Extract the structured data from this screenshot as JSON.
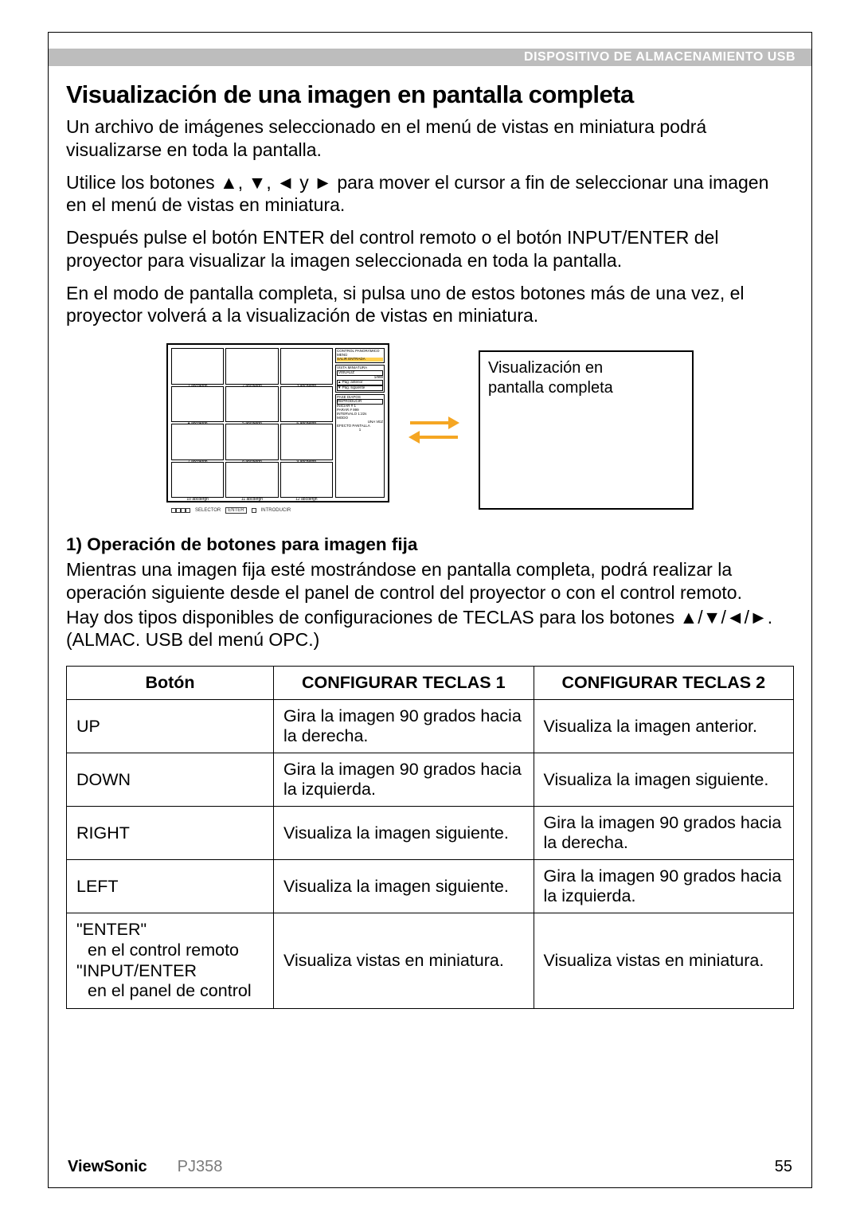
{
  "header": {
    "section": "DISPOSITIVO DE ALMACENAMIENTO USB"
  },
  "title": "Visualización de una imagen en pantalla completa",
  "paragraphs": {
    "p1": "Un archivo de imágenes seleccionado en el menú de vistas en miniatura podrá visualizarse en toda la pantalla.",
    "p2": "Utilice los botones ▲, ▼, ◄ y ► para mover el cursor a fin de seleccionar una imagen en el menú de vistas en miniatura.",
    "p3": "Después pulse el botón ENTER del control remoto o el botón INPUT/ENTER del proyector para visualizar la imagen seleccionada en toda la pantalla.",
    "p4": "En el modo de pantalla completa, si pulsa uno de estos botones más de una vez, el proyector volverá a la visualización de vistas en miniatura."
  },
  "diagram": {
    "thumbnails": {
      "cells": [
        "1 abcdefgh",
        "2 abcdefgh",
        "3 abcdefgh",
        "4 abcdefgh",
        "5 abcdefgh",
        "6 abcdefgh",
        "7 abcdefgh",
        "8 abcdefgh",
        "9 abcdefgh",
        "10 abcdefgh",
        "11 abcdefgh",
        "12 abcdefgh"
      ],
      "side_panel": {
        "control": "CONTROL PANORÁMICO",
        "menu": "MENÚ",
        "salir": "SALIR   ENTRADA",
        "vista_title": "VISTA MINIATURA",
        "visualiz": "VISUALIZ",
        "count": "1/999",
        "prev": "▲ Pág.  anterior",
        "next": "▼ Pág.  siguiente",
        "pase_title": "PASE DIAPOS",
        "reproducir": "REPRODUCIR",
        "iniciar": "INICIAR   #   1",
        "parar": "PARAR    #  999",
        "intervalo": "INTERVALO  1:22s",
        "modo": "MODO",
        "una_vez": "UNA VEZ",
        "efecto": "EFECTO PANTALLA",
        "efecto_val": "1"
      },
      "footer": {
        "selector": "SELECTOR",
        "enter": "ENTER",
        "introducir": "INTRODUCIR"
      }
    },
    "fullscreen_label_line1": "Visualización en",
    "fullscreen_label_line2": "pantalla completa"
  },
  "subheading": "1) Operación de botones para imagen fija",
  "sub_paras": {
    "sp1": "Mientras una imagen fija esté mostrándose en pantalla completa, podrá realizar la operación siguiente desde el panel de control del proyector o con el control remoto.",
    "sp2": "Hay dos tipos disponibles de configuraciones de TECLAS para los botones ▲/▼/◄/►. (ALMAC. USB del menú OPC.)"
  },
  "table": {
    "headers": {
      "h1": "Botón",
      "h2": "CONFIGURAR TECLAS 1",
      "h3": "CONFIGURAR TECLAS 2"
    },
    "rows": [
      {
        "btn": "UP",
        "c1": "Gira la imagen 90 grados hacia la derecha.",
        "c2": "Visualiza la imagen anterior."
      },
      {
        "btn": "DOWN",
        "c1": "Gira la imagen 90 grados hacia la izquierda.",
        "c2": "Visualiza la imagen siguiente."
      },
      {
        "btn": "RIGHT",
        "c1": "Visualiza la imagen siguiente.",
        "c2": "Gira la imagen 90 grados hacia la derecha."
      },
      {
        "btn": "LEFT",
        "c1": "Visualiza la imagen siguiente.",
        "c2": "Gira la imagen 90 grados hacia la izquierda."
      }
    ],
    "row5": {
      "line1": "\"ENTER\"",
      "line2": "en el control remoto",
      "line3": "\"INPUT/ENTER",
      "line4": "en el panel de control",
      "c1": "Visualiza vistas en miniatura.",
      "c2": "Visualiza vistas en miniatura."
    }
  },
  "footer": {
    "brand": "ViewSonic",
    "model": "PJ358",
    "page": "55"
  }
}
